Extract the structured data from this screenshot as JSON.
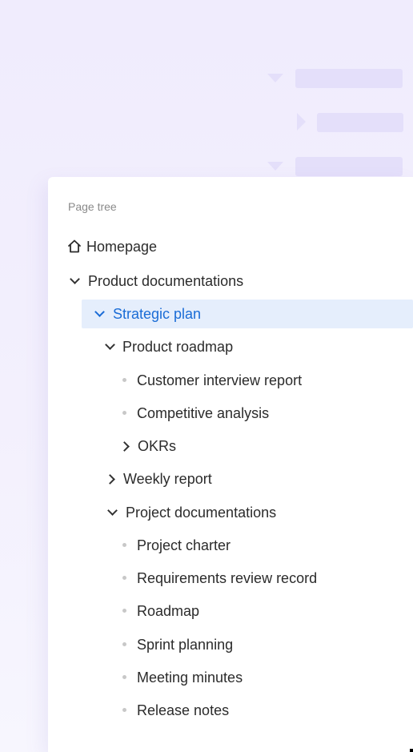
{
  "panel": {
    "title": "Page tree"
  },
  "tree": {
    "homepage": "Homepage",
    "product_docs": "Product documentations",
    "strategic_plan": "Strategic plan",
    "product_roadmap": "Product roadmap",
    "customer_interview": "Customer interview report",
    "competitive_analysis": "Competitive analysis",
    "okrs": "OKRs",
    "weekly_report": "Weekly report",
    "project_docs": "Project documentations",
    "project_charter": "Project charter",
    "requirements_review": "Requirements review record",
    "roadmap": "Roadmap",
    "sprint_planning": "Sprint planning",
    "meeting_minutes": "Meeting minutes",
    "release_notes": "Release notes"
  },
  "icons": {
    "home": "home-icon",
    "expand": "chevron-down-icon",
    "collapse": "chevron-right-icon",
    "leaf": "bullet-dot-icon"
  },
  "colors": {
    "selected_bg": "#e5eefc",
    "selected_text": "#1a6cd6",
    "background": "#f0ecfd"
  }
}
